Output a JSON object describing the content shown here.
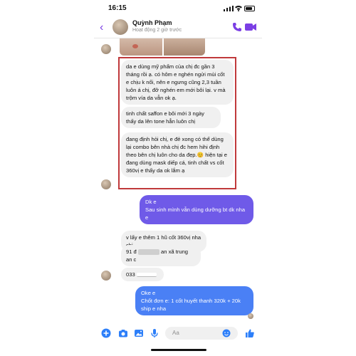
{
  "status_bar": {
    "time": "16:15"
  },
  "header": {
    "name": "Quỳnh Phạm",
    "subtitle": "Hoạt động 2 giờ trước"
  },
  "messages": [
    {
      "side": "in",
      "text": "da e dùng mỹ phẩm của chị đc gần 3 tháng rồi ạ. có hôm e nghén ngửi mùi cốt e chịu k nổi, nên e ngưng cũng 2,3 tuần luôn á chị, đỡ nghén em mới bôi lại. v mà trộm vía da vẫn ok ạ."
    },
    {
      "side": "in",
      "text": "tinh chất saffon e bôi mới 3 ngày thấy da lên tone hẳn luôn chị"
    },
    {
      "side": "in",
      "text": "đang định hỏi chị, e đẻ xong có thể dùng lại combo bên nhà chị đc hem hihi định theo bên chị luôn cho da đẹp.😊 hiện tại e đang dùng mask diếp cá, tinh chất vs cốt 360vị e thấy da ok lắm ạ"
    },
    {
      "side": "out",
      "text": "Dk e\nSau sinh mình vẫn dùng dưỡng bt dk nha e"
    },
    {
      "side": "in",
      "text": "v lấy e thêm 1 hũ cốt 360vị nha chị"
    },
    {
      "side": "in",
      "text_start": "91 đ",
      "text_mid": "an xã trung",
      "text_end": "an c"
    },
    {
      "side": "in",
      "text": "033"
    },
    {
      "side": "out",
      "text": "Oke e\nChốt đơn e: 1 cốt huyết thanh 320k + 20k ship e nha"
    }
  ],
  "composer": {
    "placeholder": "Aa"
  },
  "colors": {
    "accent": "#7b3fe4",
    "outgoing_blue": "#4a80f5",
    "outgoing_violet": "#6f5ae8",
    "highlight": "#c0393b"
  }
}
